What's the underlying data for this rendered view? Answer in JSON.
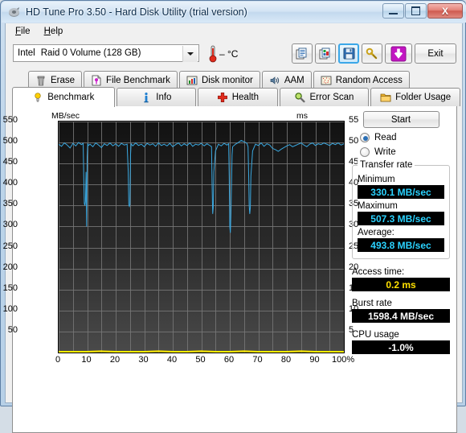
{
  "window": {
    "title": "HD Tune Pro 3.50 - Hard Disk Utility (trial version)",
    "minimize_label": "",
    "maximize_label": "",
    "close_label": "X"
  },
  "menu": [
    {
      "label": "File",
      "accel": "F",
      "rest": "ile"
    },
    {
      "label": "Help",
      "accel": "H",
      "rest": "elp"
    }
  ],
  "toolbar": {
    "drive_brand": "Intel",
    "drive_name": "Raid 0 Volume (128 GB)",
    "temperature": "– °C",
    "buttons": [
      {
        "name": "copy-icon",
        "label": ""
      },
      {
        "name": "copy-image-icon",
        "label": ""
      },
      {
        "name": "save-icon",
        "label": ""
      },
      {
        "name": "options-icon",
        "label": ""
      },
      {
        "name": "download-icon",
        "label": ""
      }
    ],
    "exit_label": "Exit"
  },
  "tabs": {
    "row1": [
      {
        "label": "Erase",
        "icon": "trash-icon"
      },
      {
        "label": "File Benchmark",
        "icon": "file-benchmark-icon"
      },
      {
        "label": "Disk monitor",
        "icon": "bar-chart-icon"
      },
      {
        "label": "AAM",
        "icon": "speaker-icon"
      },
      {
        "label": "Random Access",
        "icon": "random-access-icon"
      }
    ],
    "row2": [
      {
        "label": "Benchmark",
        "icon": "lightbulb-icon",
        "active": true
      },
      {
        "label": "Info",
        "icon": "info-icon",
        "active": false
      },
      {
        "label": "Health",
        "icon": "health-cross-icon",
        "active": false
      },
      {
        "label": "Error Scan",
        "icon": "magnifier-icon",
        "active": false
      },
      {
        "label": "Folder Usage",
        "icon": "folder-icon",
        "active": false
      }
    ]
  },
  "panel": {
    "start_label": "Start",
    "mode_read": "Read",
    "mode_write": "Write",
    "mode_selected": "Read",
    "transfer_rate_title": "Transfer rate",
    "minimum_label": "Minimum",
    "minimum_value": "330.1 MB/sec",
    "maximum_label": "Maximum",
    "maximum_value": "507.3 MB/sec",
    "average_label": "Average:",
    "average_value": "493.8 MB/sec",
    "access_time_label": "Access time:",
    "access_time_value": "0.2 ms",
    "burst_rate_label": "Burst rate",
    "burst_rate_value": "1598.4 MB/sec",
    "cpu_usage_label": "CPU usage",
    "cpu_usage_value": "-1.0%"
  },
  "chart_data": {
    "type": "line",
    "title": "",
    "watermark": "trial version",
    "xlabel": "",
    "ylabel": "MB/sec",
    "y2label": "ms",
    "xlim": [
      0,
      100
    ],
    "ylim": [
      0,
      550
    ],
    "y2lim": [
      0,
      55
    ],
    "grid": true,
    "xticks": [
      "0",
      "10",
      "20",
      "30",
      "40",
      "50",
      "60",
      "70",
      "80",
      "90",
      "100%"
    ],
    "yticks": [
      550,
      500,
      450,
      400,
      350,
      300,
      250,
      200,
      150,
      100,
      50
    ],
    "y2ticks": [
      55,
      50,
      45,
      40,
      35,
      30,
      25,
      20,
      15,
      10,
      5
    ],
    "colors": {
      "transfer_rate": "#3aa8e0",
      "access_time": "#ffee00",
      "background": "#111111",
      "grid": "#777777"
    },
    "series": [
      {
        "name": "Transfer rate",
        "unit": "MB/sec",
        "axis": "left",
        "color": "#3aa8e0",
        "x": [
          0,
          1,
          2,
          3,
          4,
          5,
          6,
          7,
          8,
          8.6,
          8.8,
          9.0,
          9.2,
          9.4,
          9.6,
          9.8,
          10,
          10.2,
          10.4,
          11,
          12,
          13,
          14,
          15,
          16,
          17,
          18,
          19,
          20,
          21,
          22,
          23,
          24,
          24.4,
          24.6,
          24.8,
          25,
          25.2,
          25.4,
          26,
          27,
          28,
          29,
          30,
          31,
          32,
          33,
          34,
          35,
          36,
          37,
          38,
          39,
          40,
          41,
          42,
          43,
          44,
          45,
          46,
          47,
          48,
          49,
          50,
          51,
          52,
          53,
          53.6,
          53.8,
          54,
          54.2,
          54.4,
          55,
          56,
          57,
          58,
          59,
          59.6,
          59.8,
          60,
          60.2,
          60.4,
          60.6,
          60.8,
          61,
          62,
          63,
          64,
          65,
          66,
          66.4,
          66.6,
          66.8,
          67,
          67.2,
          67.4,
          68,
          69,
          70,
          71,
          72,
          73,
          74,
          75,
          76,
          77,
          78,
          79,
          80,
          81,
          82,
          83,
          84,
          85,
          86,
          87,
          88,
          89,
          90,
          91,
          92,
          93,
          94,
          95,
          96,
          97,
          98,
          99,
          100
        ],
        "y": [
          496,
          491,
          499,
          494,
          487,
          498,
          492,
          500,
          495,
          498,
          420,
          355,
          350,
          360,
          430,
          300,
          465,
          498,
          493,
          496,
          490,
          499,
          494,
          488,
          497,
          493,
          499,
          492,
          497,
          491,
          498,
          494,
          496,
          430,
          352,
          348,
          352,
          470,
          497,
          492,
          499,
          493,
          496,
          490,
          498,
          494,
          497,
          491,
          499,
          493,
          496,
          492,
          498,
          490,
          495,
          499,
          492,
          497,
          493,
          499,
          491,
          496,
          494,
          498,
          492,
          497,
          493,
          490,
          400,
          330,
          345,
          430,
          480,
          496,
          492,
          498,
          494,
          497,
          420,
          300,
          285,
          330,
          400,
          470,
          490,
          496,
          500,
          505,
          502,
          498,
          490,
          430,
          350,
          330,
          345,
          420,
          480,
          496,
          493,
          499,
          491,
          497,
          494,
          486,
          483,
          479,
          484,
          488,
          492,
          495,
          490,
          493,
          496,
          499,
          494,
          490,
          496,
          499,
          493,
          497,
          495,
          499,
          496,
          493,
          498,
          495,
          499,
          494,
          497
        ]
      },
      {
        "name": "Access time",
        "unit": "ms",
        "axis": "right",
        "color": "#ffee00",
        "x": [
          0,
          5,
          10,
          15,
          20,
          25,
          30,
          35,
          40,
          45,
          50,
          55,
          60,
          65,
          70,
          75,
          80,
          85,
          90,
          95,
          100
        ],
        "y": [
          0.2,
          0.2,
          0.2,
          0.3,
          0.2,
          0.2,
          0.2,
          0.3,
          0.2,
          0.2,
          0.3,
          0.2,
          0.2,
          0.3,
          0.2,
          0.2,
          0.2,
          0.3,
          0.2,
          0.2,
          0.2
        ]
      }
    ]
  }
}
